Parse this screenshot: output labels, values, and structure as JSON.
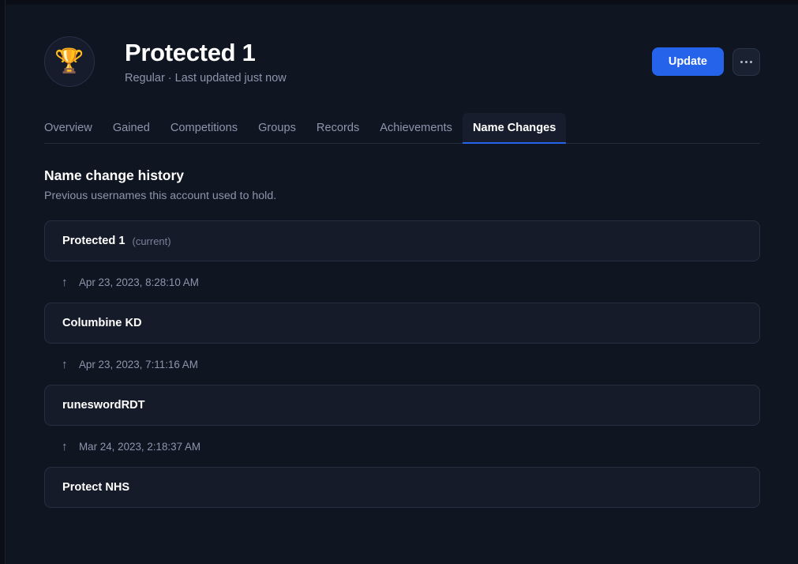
{
  "header": {
    "avatar_icon": "trophy-icon",
    "avatar_glyph": "🏆",
    "title": "Protected 1",
    "subtitle": "Regular · Last updated just now",
    "update_label": "Update",
    "more_label": "···"
  },
  "tabs": [
    {
      "label": "Overview",
      "active": false
    },
    {
      "label": "Gained",
      "active": false
    },
    {
      "label": "Competitions",
      "active": false
    },
    {
      "label": "Groups",
      "active": false
    },
    {
      "label": "Records",
      "active": false
    },
    {
      "label": "Achievements",
      "active": false
    },
    {
      "label": "Name Changes",
      "active": true
    }
  ],
  "section": {
    "title": "Name change history",
    "description": "Previous usernames this account used to hold."
  },
  "timeline": {
    "entries": [
      {
        "name": "Protected 1",
        "tag": "(current)"
      },
      {
        "name": "Columbine KD",
        "tag": ""
      },
      {
        "name": "runeswordRDT",
        "tag": ""
      },
      {
        "name": "Protect NHS",
        "tag": ""
      }
    ],
    "transitions": [
      {
        "icon": "arrow-up-icon",
        "glyph": "↑",
        "timestamp": "Apr 23, 2023, 8:28:10 AM"
      },
      {
        "icon": "arrow-up-icon",
        "glyph": "↑",
        "timestamp": "Apr 23, 2023, 7:11:16 AM"
      },
      {
        "icon": "arrow-up-icon",
        "glyph": "↑",
        "timestamp": "Mar 24, 2023, 2:18:37 AM"
      }
    ]
  },
  "colors": {
    "accent": "#2563eb",
    "background": "#101522",
    "card": "#151b29",
    "muted_text": "#8d95ab"
  }
}
